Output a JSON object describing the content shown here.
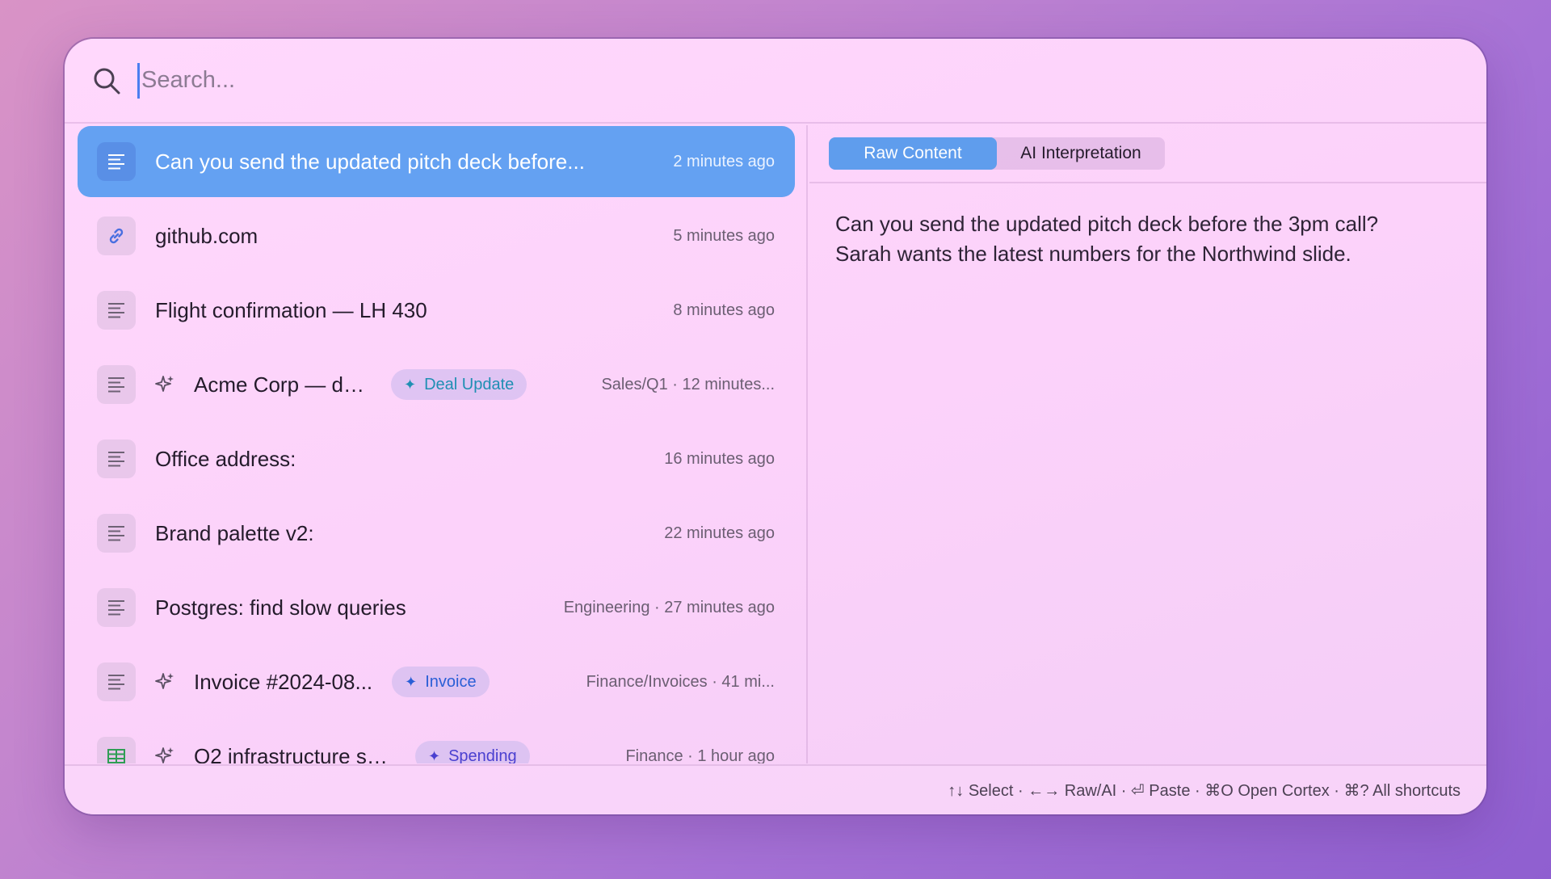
{
  "search": {
    "placeholder": "Search..."
  },
  "items": [
    {
      "icon": "text-lines-icon",
      "title": "Can you send the updated pitch deck before...",
      "meta": "2 minutes ago",
      "selected": true
    },
    {
      "icon": "link-icon",
      "title": "github.com",
      "meta": "5 minutes ago"
    },
    {
      "icon": "text-lines-icon",
      "title": "Flight confirmation — LH 430",
      "meta": "8 minutes ago"
    },
    {
      "icon": "text-lines-icon",
      "ai": true,
      "title": "Acme Corp — de...",
      "tag": "Deal Update",
      "tag_color": "#1f8fb3",
      "meta": "Sales/Q1 · 12 minutes..."
    },
    {
      "icon": "text-lines-icon",
      "title": "Office address:",
      "meta": "16 minutes ago"
    },
    {
      "icon": "text-lines-icon",
      "title": "Brand palette v2:",
      "meta": "22 minutes ago"
    },
    {
      "icon": "text-lines-icon",
      "title": "Postgres: find slow queries",
      "meta": "Engineering · 27 minutes ago"
    },
    {
      "icon": "text-lines-icon",
      "ai": true,
      "title": "Invoice #2024-08...",
      "tag": "Invoice",
      "tag_color": "#2a5fd6",
      "meta": "Finance/Invoices · 41 mi..."
    },
    {
      "icon": "table-icon",
      "ai": true,
      "title": "Q2 infrastructure spe...",
      "tag": "Spending",
      "tag_color": "#4a3fd0",
      "meta": "Finance · 1 hour ago"
    }
  ],
  "detail": {
    "tabs": [
      {
        "label": "Raw Content",
        "active": true
      },
      {
        "label": "AI Interpretation",
        "active": false
      }
    ],
    "content_lines": [
      "Can you send the updated pitch deck before the 3pm call?",
      "Sarah wants the latest numbers for the Northwind slide."
    ]
  },
  "footer": {
    "shortcuts": "↑↓ Select · ←→ Raw/AI · ⏎ Paste · ⌘O Open Cortex · ⌘? All shortcuts"
  },
  "colors": {
    "selected_row": "#64a1f2",
    "active_tab": "#5f9ded",
    "cursor": "#4a7ef0"
  }
}
